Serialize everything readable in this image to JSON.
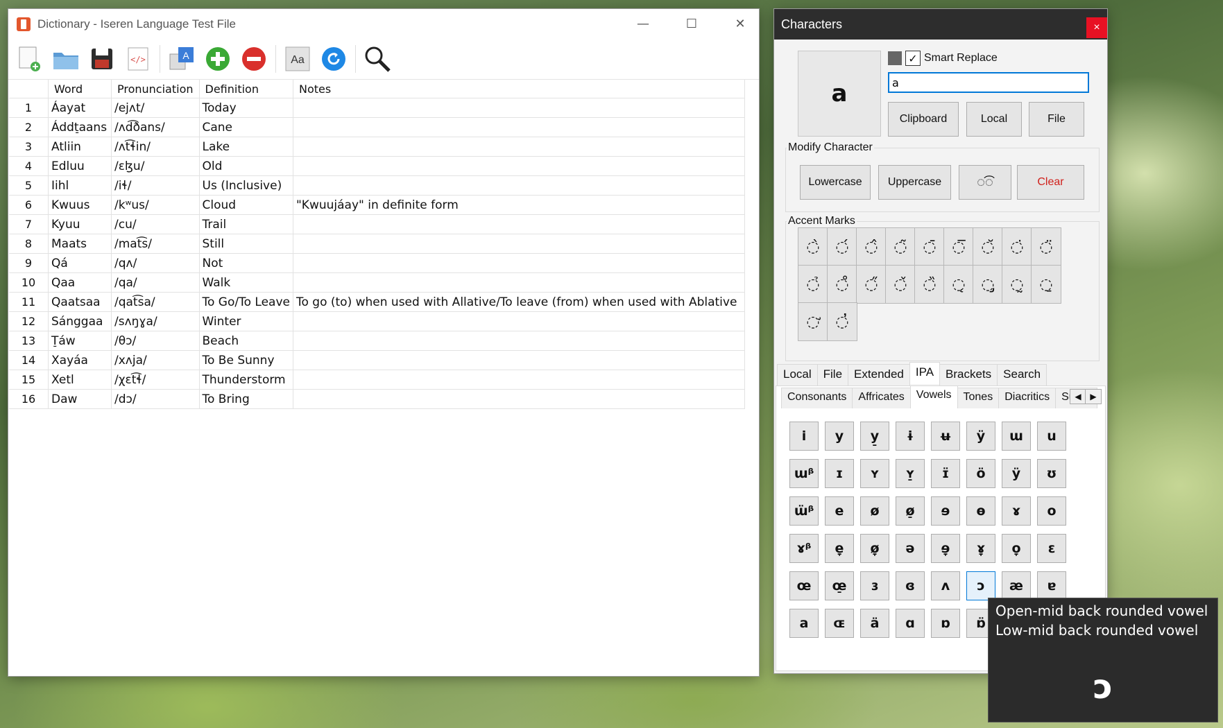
{
  "dictionary_window": {
    "title": "Dictionary - Iseren Language Test File",
    "controls": {
      "minimize": "—",
      "maximize": "☐",
      "close": "✕"
    },
    "toolbar": [
      "new-file",
      "open-folder",
      "save",
      "source-code",
      "language-settings",
      "add-entry",
      "remove-entry",
      "font",
      "refresh",
      "search"
    ],
    "columns": [
      "",
      "Word",
      "Pronunciation",
      "Definition",
      "Notes"
    ],
    "rows": [
      {
        "num": "1",
        "word": "Áayat",
        "pron": "/ejʌt/",
        "def": "Today",
        "notes": ""
      },
      {
        "num": "2",
        "word": "Áddt̠aans",
        "pron": "/ʌd͡ðans/",
        "def": "Cane",
        "notes": ""
      },
      {
        "num": "3",
        "word": "Atliin",
        "pron": "/ʌt͡ɬin/",
        "def": "Lake",
        "notes": ""
      },
      {
        "num": "4",
        "word": "Edluu",
        "pron": "/ɛɮu/",
        "def": "Old",
        "notes": ""
      },
      {
        "num": "5",
        "word": "Iihl",
        "pron": "/iɬ/",
        "def": "Us (Inclusive)",
        "notes": ""
      },
      {
        "num": "6",
        "word": "Kwuus",
        "pron": "/kʷus/",
        "def": "Cloud",
        "notes": "\"Kwuujáay\" in definite form"
      },
      {
        "num": "7",
        "word": "Kyuu",
        "pron": "/cu/",
        "def": "Trail",
        "notes": ""
      },
      {
        "num": "8",
        "word": "Maats",
        "pron": "/mat͡s/",
        "def": "Still",
        "notes": ""
      },
      {
        "num": "9",
        "word": "Qá",
        "pron": "/qʌ/",
        "def": "Not",
        "notes": ""
      },
      {
        "num": "10",
        "word": "Qaa",
        "pron": "/qa/",
        "def": "Walk",
        "notes": ""
      },
      {
        "num": "11",
        "word": "Qaatsaa",
        "pron": "/qat͡sa/",
        "def": "To Go/To Leave",
        "notes": "To go (to) when used with Allative/To leave (from) when used with Ablative"
      },
      {
        "num": "12",
        "word": "Sánggaa",
        "pron": "/sʌŋɣa/",
        "def": "Winter",
        "notes": ""
      },
      {
        "num": "13",
        "word": "T̠áw",
        "pron": "/θɔ/",
        "def": "Beach",
        "notes": ""
      },
      {
        "num": "14",
        "word": "Xayáa",
        "pron": "/xʌja/",
        "def": "To Be Sunny",
        "notes": ""
      },
      {
        "num": "15",
        "word": "Xetl",
        "pron": "/χɛt͡ɬ/",
        "def": "Thunderstorm",
        "notes": ""
      },
      {
        "num": "16",
        "word": "Daw",
        "pron": "/dɔ/",
        "def": "To Bring",
        "notes": ""
      }
    ]
  },
  "characters_window": {
    "title": "Characters",
    "close": "×",
    "preview_char": "a",
    "smart_replace_label": "Smart Replace",
    "input_value": "a",
    "source_buttons": [
      "Clipboard",
      "Local",
      "File"
    ],
    "modify_label": "Modify Character",
    "modify_buttons": [
      "Lowercase",
      "Uppercase",
      "◌͡◌",
      "Clear"
    ],
    "accent_label": "Accent Marks",
    "accents": [
      "◌̀",
      "◌́",
      "◌̂",
      "◌̃",
      "◌̄",
      "◌̅",
      "◌̆",
      "◌̇",
      "◌̈",
      "◌̉",
      "◌̊",
      "◌̋",
      "◌̌",
      "◌̏",
      "◌̨",
      "◌̡",
      "◌̰",
      "◌̱",
      "◌̛",
      "◌̓"
    ],
    "tabs_top": [
      "Local",
      "File",
      "Extended",
      "IPA",
      "Brackets",
      "Search"
    ],
    "tabs_top_active": "IPA",
    "tabs_sub": [
      "Consonants",
      "Affricates",
      "Vowels",
      "Tones",
      "Diacritics",
      "Supra"
    ],
    "tabs_sub_active": "Vowels",
    "vowels": [
      [
        "i",
        "y",
        "y̠",
        "ɨ",
        "ʉ",
        "ÿ",
        "ɯ",
        "u"
      ],
      [
        "ɯᵝ",
        "ɪ",
        "ʏ",
        "ʏ̠",
        "ɪ̈",
        "ö",
        "ÿ",
        "ʊ"
      ],
      [
        "ɯ̈ᵝ",
        "e",
        "ø",
        "ø̠",
        "ɘ",
        "ɵ",
        "ɤ",
        "o"
      ],
      [
        "ɤᵝ",
        "e̞",
        "ø̞",
        "ə",
        "ɘ̞",
        "ɤ̞",
        "o̞",
        "ɛ"
      ],
      [
        "œ",
        "œ̠",
        "ɜ",
        "ɞ",
        "ʌ",
        "ɔ",
        "æ",
        "ɐ"
      ],
      [
        "a",
        "ɶ",
        "ä",
        "ɑ",
        "ɒ",
        "ɒ̈",
        "",
        ""
      ]
    ],
    "selected_vowel": "ɔ"
  },
  "tooltip": {
    "line1": "Open-mid back rounded vowel",
    "line2": "Low-mid back rounded vowel",
    "char": "ɔ"
  }
}
